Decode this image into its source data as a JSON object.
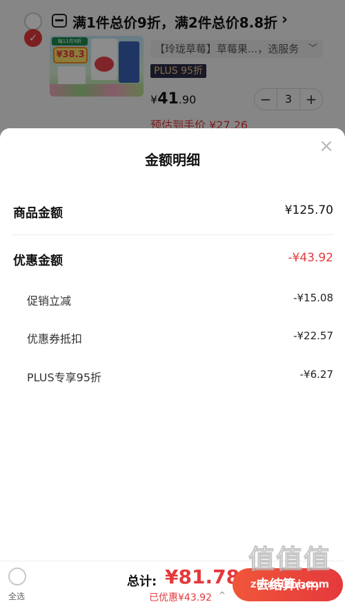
{
  "cart": {
    "promo_text": "满1件总价9折，满2件总价8.8折",
    "promo_arrow": "›",
    "product": {
      "image_badge_tag": "每11件9折",
      "image_price_badge": "¥38.3",
      "spec": "【玲珑草莓】草莓果...，选服务",
      "plus_tag": "PLUS 95折",
      "price_symbol": "¥",
      "price_int": "41",
      "price_dec": ".90",
      "estimated_price": "预估到手价 ¥27.26",
      "quantity": "3",
      "minus_label": "−",
      "plus_label": "+"
    }
  },
  "sheet": {
    "title": "金额明细",
    "close_label": "×",
    "goods_amount": {
      "label": "商品金额",
      "value": "¥125.70"
    },
    "discount_amount": {
      "label": "优惠金额",
      "value": "-¥43.92"
    },
    "discounts": [
      {
        "label": "促销立减",
        "value": "-¥15.08"
      },
      {
        "label": "优惠券抵扣",
        "value": "-¥22.57"
      },
      {
        "label": "PLUS专享95折",
        "value": "-¥6.27"
      }
    ]
  },
  "bottom_bar": {
    "select_all_label": "全选",
    "total_label": "总计:",
    "total_value": "¥81.78",
    "saved_text": "已优惠¥43.92",
    "saved_arrow": "^",
    "checkout_label": "去结算",
    "checkout_count": "(3件)"
  },
  "watermark": {
    "logo": "值值值",
    "url": "zhizhizhi.com"
  },
  "colors": {
    "accent_red": "#e4393c",
    "plus_gold": "#e9c98a",
    "plus_dark": "#2c2c4a"
  }
}
